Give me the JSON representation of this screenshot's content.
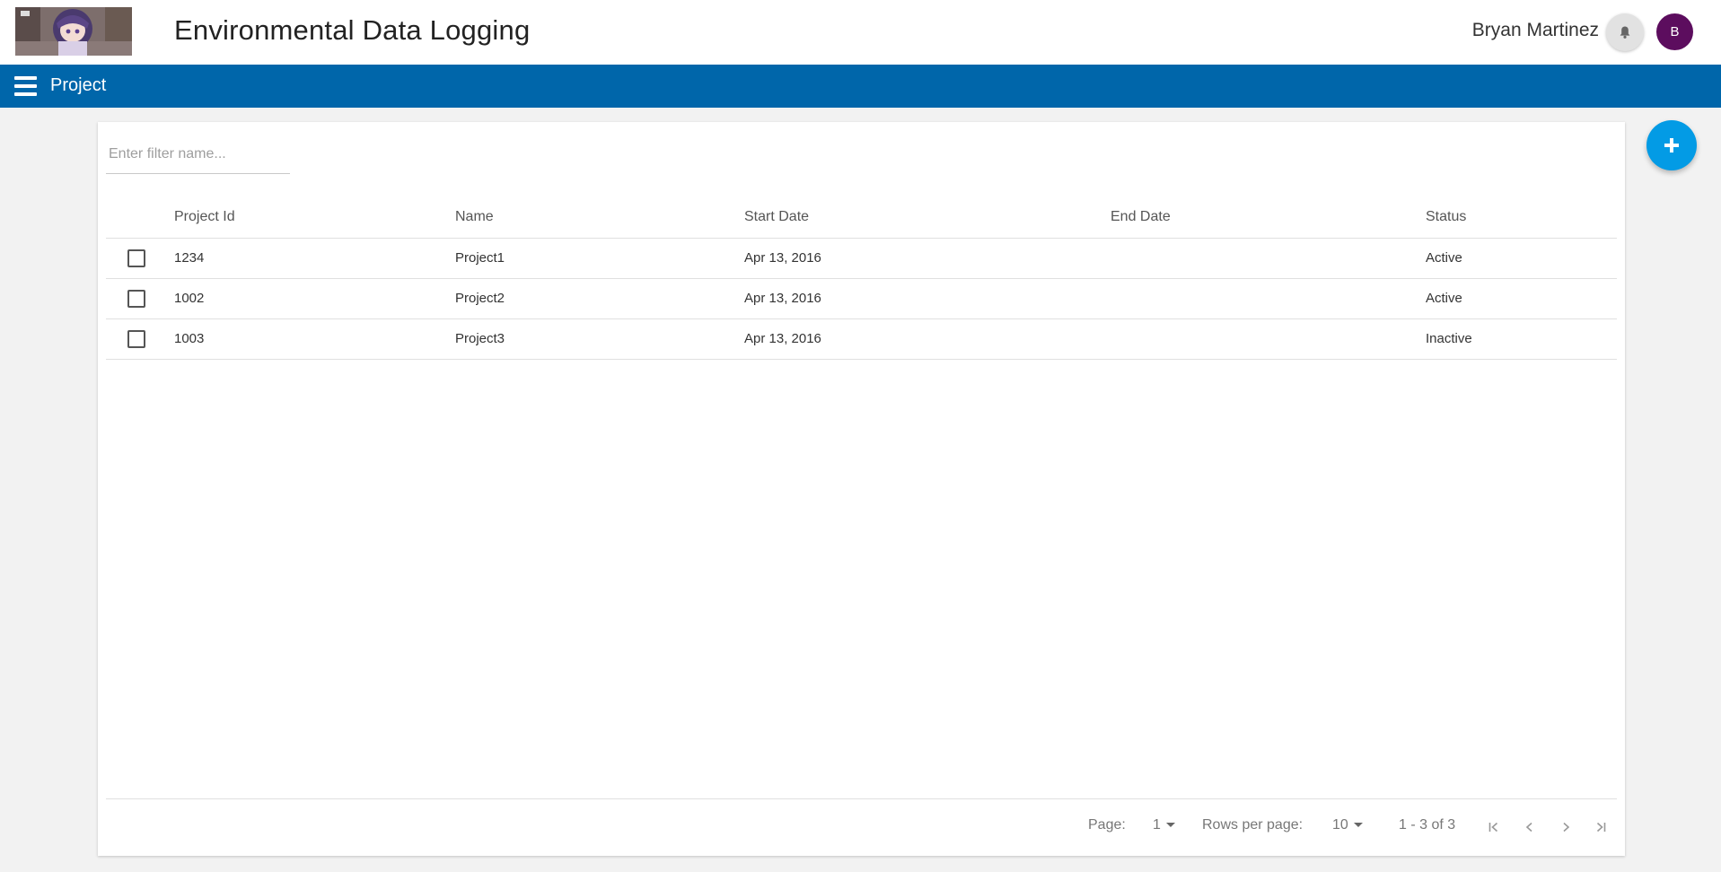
{
  "header": {
    "app_title": "Environmental Data Logging",
    "user_name": "Bryan Martinez",
    "avatar_initial": "B",
    "avatar_color": "#5c0d5e",
    "notification_icon": "bell-icon"
  },
  "navbar": {
    "title": "Project",
    "menu_icon": "hamburger-menu-icon",
    "color": "#0066aa"
  },
  "filter": {
    "placeholder": "Enter filter name...",
    "value": ""
  },
  "table": {
    "columns": [
      "Project Id",
      "Name",
      "Start Date",
      "End Date",
      "Status"
    ],
    "rows": [
      {
        "id": "1234",
        "name": "Project1",
        "start_date": "Apr 13, 2016",
        "end_date": "",
        "status": "Active",
        "checked": false
      },
      {
        "id": "1002",
        "name": "Project2",
        "start_date": "Apr 13, 2016",
        "end_date": "",
        "status": "Active",
        "checked": false
      },
      {
        "id": "1003",
        "name": "Project3",
        "start_date": "Apr 13, 2016",
        "end_date": "",
        "status": "Inactive",
        "checked": false
      }
    ]
  },
  "pagination": {
    "page_label": "Page:",
    "page_value": "1",
    "rows_per_page_label": "Rows per page:",
    "rows_per_page_value": "10",
    "range_text": "1 - 3 of 3"
  },
  "fab": {
    "icon": "plus-icon",
    "color": "#039be5"
  }
}
